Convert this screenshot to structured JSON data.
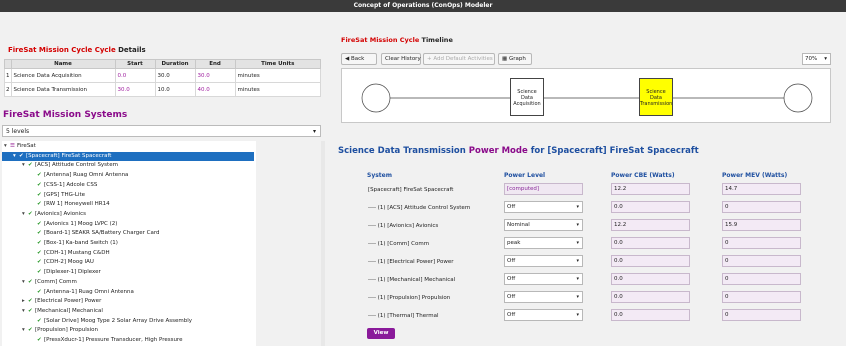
{
  "window": {
    "title": "Concept of Operations (ConOps) Modeler"
  },
  "details": {
    "title_red": "FireSat Mission Cycle Cycle",
    "title_rest": " Details",
    "headers": [
      "Name",
      "Start",
      "Duration",
      "End",
      "Time Units"
    ],
    "rows": [
      {
        "idx": "1",
        "name": "Science Data Acquisition",
        "start": "0.0",
        "duration": "30.0",
        "end": "30.0",
        "units": "minutes"
      },
      {
        "idx": "2",
        "name": "Science Data Transmission",
        "start": "30.0",
        "duration": "10.0",
        "end": "40.0",
        "units": "minutes"
      }
    ]
  },
  "systems": {
    "title": "FireSat Mission Systems",
    "levels": "5 levels",
    "tree": [
      {
        "t": "FireSat",
        "d": 0,
        "tog": "▾",
        "root": true
      },
      {
        "t": "[Spacecraft] FireSat Spacecraft",
        "d": 1,
        "tog": "▾",
        "sel": true
      },
      {
        "t": "[ACS] Attitude Control System",
        "d": 2,
        "tog": "▾"
      },
      {
        "t": "[Antenna] Ruag Omni Antenna",
        "d": 3
      },
      {
        "t": "[CSS-1] Adcole CSS",
        "d": 3
      },
      {
        "t": "[GPS] THG-Lite",
        "d": 3
      },
      {
        "t": "[RW 1] Honeywell HR14",
        "d": 3
      },
      {
        "t": "[Avionics] Avionics",
        "d": 2,
        "tog": "▾"
      },
      {
        "t": "[Avionics 1] Moog LVPC (2)",
        "d": 3
      },
      {
        "t": "[Board-1] SEAKR SA/Battery Charger Card",
        "d": 3
      },
      {
        "t": "[Box-1] Ka-band Switch (1)",
        "d": 3
      },
      {
        "t": "[CDH-1] Mustang C&DH",
        "d": 3
      },
      {
        "t": "[CDH-2] Moog IAU",
        "d": 3
      },
      {
        "t": "[Diplexer-1] Diplexer",
        "d": 3
      },
      {
        "t": "[Comm] Comm",
        "d": 2,
        "tog": "▾"
      },
      {
        "t": "[Antenna-1] Ruag Omni Antenna",
        "d": 3
      },
      {
        "t": "[Electrical Power] Power",
        "d": 2,
        "tog": "▸"
      },
      {
        "t": "[Mechanical] Mechanical",
        "d": 2,
        "tog": "▾"
      },
      {
        "t": "[Solar Drive] Moog Type 2 Solar Array Drive Assembly",
        "d": 3
      },
      {
        "t": "[Propulsion] Propulsion",
        "d": 2,
        "tog": "▾"
      },
      {
        "t": "[PressXducr-1] Pressure Transducer, High Pressure",
        "d": 3
      }
    ]
  },
  "timeline": {
    "title_red": "FireSat Mission Cycle",
    "title_rest": " Timeline",
    "buttons": {
      "back": "Back",
      "clear": "Clear History",
      "add": "Add Default Activities",
      "graph": "Graph"
    },
    "zoom": "70%",
    "activities": [
      "Science Data Acquisition",
      "Science Data Transmission"
    ]
  },
  "power": {
    "title_a": "Science Data Transmission ",
    "title_b": "Power Mode",
    "title_c": " for [Spacecraft] FireSat Spacecraft",
    "headers": {
      "system": "System",
      "level": "Power Level",
      "cbe": "Power CBE (Watts)",
      "mev": "Power MEV (Watts)"
    },
    "rows": [
      {
        "sys": "[Spacecraft] FireSat Spacecraft",
        "level": "[computed]",
        "cbe": "12.2",
        "mev": "14.7",
        "ro": true
      },
      {
        "sys": "---- (1) [ACS] Attitude Control System",
        "level": "Off",
        "cbe": "0.0",
        "mev": "0"
      },
      {
        "sys": "---- (1) [Avionics] Avionics",
        "level": "Nominal",
        "cbe": "12.2",
        "mev": "15.9"
      },
      {
        "sys": "---- (1) [Comm] Comm",
        "level": "peak",
        "cbe": "0.0",
        "mev": "0"
      },
      {
        "sys": "---- (1) [Electrical Power] Power",
        "level": "Off",
        "cbe": "0.0",
        "mev": "0"
      },
      {
        "sys": "---- (1) [Mechanical] Mechanical",
        "level": "Off",
        "cbe": "0.0",
        "mev": "0"
      },
      {
        "sys": "---- (1) [Propulsion] Propulsion",
        "level": "Off",
        "cbe": "0.0",
        "mev": "0"
      },
      {
        "sys": "---- (1) [Thermal] Thermal",
        "level": "Off",
        "cbe": "0.0",
        "mev": "0"
      }
    ],
    "view": "View"
  }
}
